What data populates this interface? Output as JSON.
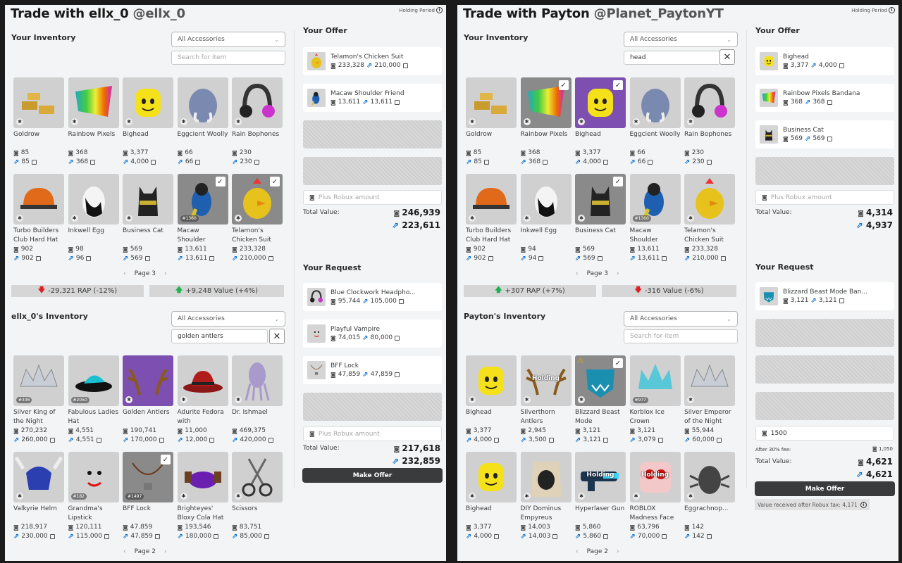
{
  "holding_label": "Holding Period",
  "left": {
    "title": "Trade with ellx_0",
    "handle": "@ellx_0",
    "your_inventory": {
      "label": "Your Inventory",
      "filter": "All Accessories",
      "search": "Search for item",
      "page": "Page 3",
      "items": [
        {
          "name": "Goldrow",
          "rap": "85",
          "value": "85",
          "icon": "gold-bars-icon"
        },
        {
          "name": "Rainbow Pixels",
          "rap": "368",
          "value": "368",
          "icon": "rainbow-bandana-icon"
        },
        {
          "name": "Bighead",
          "rap": "3,377",
          "value": "4,000",
          "icon": "yellow-head-icon"
        },
        {
          "name": "Eggcient Woolly",
          "rap": "66",
          "value": "66",
          "icon": "mammoth-egg-icon"
        },
        {
          "name": "Rain Bophones",
          "rap": "230",
          "value": "230",
          "icon": "headphones-icon"
        },
        {
          "name": "Turbo Builders Club Hard Hat",
          "rap": "902",
          "value": "902",
          "icon": "hard-hat-icon"
        },
        {
          "name": "Inkwell Egg",
          "rap": "98",
          "value": "96",
          "icon": "egg-icon"
        },
        {
          "name": "Business Cat",
          "rap": "569",
          "value": "569",
          "icon": "cat-icon"
        },
        {
          "name": "Macaw Shoulder",
          "rap": "13,611",
          "value": "13,611",
          "icon": "macaw-icon",
          "selected": true,
          "serial": "#1360"
        },
        {
          "name": "Telamon's Chicken Suit",
          "rap": "233,328",
          "value": "210,000",
          "icon": "chicken-icon",
          "selected": true
        }
      ]
    },
    "rap_stat": "-29,321 RAP (-12%)",
    "value_stat": "+9,248 Value (+4%)",
    "their_inventory": {
      "label": "ellx_0's Inventory",
      "filter": "All Accessories",
      "search": "golden antlers",
      "page": "Page 2",
      "items": [
        {
          "name": "Silver King of the Night",
          "rap": "270,232",
          "value": "260,000",
          "icon": "silver-crown-icon",
          "serial": "#336"
        },
        {
          "name": "Fabulous Ladies Hat",
          "rap": "4,551",
          "value": "4,551",
          "icon": "teal-hat-icon",
          "serial": "#2050"
        },
        {
          "name": "Golden Antlers",
          "rap": "190,741",
          "value": "170,000",
          "icon": "antlers-icon",
          "purple": true
        },
        {
          "name": "Adurite Fedora with",
          "rap": "11,000",
          "value": "12,000",
          "icon": "fedora-icon"
        },
        {
          "name": "Dr. Ishmael",
          "rap": "469,375",
          "value": "420,000",
          "icon": "squid-icon"
        },
        {
          "name": "Valkyrie Helm",
          "rap": "218,917",
          "value": "230,000",
          "icon": "valkyrie-helm-icon"
        },
        {
          "name": "Grandma's Lipstick",
          "rap": "120,111",
          "value": "115,000",
          "icon": "face-icon",
          "serial": "#182"
        },
        {
          "name": "BFF Lock",
          "rap": "47,859",
          "value": "47,859",
          "icon": "lock-necklace-icon",
          "selected": true,
          "serial": "#1497"
        },
        {
          "name": "Brighteyes' Bloxy Cola Hat",
          "rap": "193,546",
          "value": "180,000",
          "icon": "cola-hat-icon"
        },
        {
          "name": "Scissors",
          "rap": "83,751",
          "value": "85,000",
          "icon": "scissors-icon"
        }
      ]
    },
    "offer": {
      "label": "Your Offer",
      "items": [
        {
          "name": "Telamon's Chicken Suit",
          "rap": "233,328",
          "value": "210,000",
          "icon": "chicken-icon"
        },
        {
          "name": "Macaw Shoulder Friend",
          "rap": "13,611",
          "value": "13,611",
          "icon": "macaw-icon"
        }
      ],
      "plus": "Plus Robux amount",
      "total_label": "Total Value:",
      "total_rap": "246,939",
      "total_value": "223,611"
    },
    "request": {
      "label": "Your Request",
      "items": [
        {
          "name": "Blue Clockwork Headpho...",
          "rap": "95,744",
          "value": "105,000",
          "icon": "headphones-icon"
        },
        {
          "name": "Playful Vampire",
          "rap": "74,015",
          "value": "80,000",
          "icon": "face-icon"
        },
        {
          "name": "BFF Lock",
          "rap": "47,859",
          "value": "47,859",
          "icon": "lock-necklace-icon"
        }
      ],
      "plus": "Plus Robux amount",
      "total_label": "Total Value:",
      "total_rap": "217,618",
      "total_value": "232,859"
    },
    "make_offer": "Make Offer"
  },
  "right": {
    "title": "Trade with Payton",
    "handle": "@Planet_PaytonYT",
    "your_inventory": {
      "label": "Your Inventory",
      "filter": "All Accessories",
      "search": "head",
      "page": "Page 3",
      "items": [
        {
          "name": "Goldrow",
          "rap": "85",
          "value": "85",
          "icon": "gold-bars-icon"
        },
        {
          "name": "Rainbow Pixels",
          "rap": "368",
          "value": "368",
          "icon": "rainbow-bandana-icon",
          "selected": true
        },
        {
          "name": "Bighead",
          "rap": "3,377",
          "value": "4,000",
          "icon": "yellow-head-icon",
          "selected": true,
          "purple": true
        },
        {
          "name": "Eggcient Woolly",
          "rap": "66",
          "value": "66",
          "icon": "mammoth-egg-icon"
        },
        {
          "name": "Rain Bophones",
          "rap": "230",
          "value": "230",
          "icon": "headphones-icon"
        },
        {
          "name": "Turbo Builders Club Hard Hat",
          "rap": "902",
          "value": "902",
          "icon": "hard-hat-icon"
        },
        {
          "name": "Inkwell Egg",
          "rap": "94",
          "value": "94",
          "icon": "egg-icon"
        },
        {
          "name": "Business Cat",
          "rap": "569",
          "value": "569",
          "icon": "cat-icon",
          "selected": true
        },
        {
          "name": "Macaw Shoulder",
          "rap": "13,611",
          "value": "13,611",
          "icon": "macaw-icon",
          "serial": "#1360"
        },
        {
          "name": "Telamon's Chicken Suit",
          "rap": "233,328",
          "value": "210,000",
          "icon": "chicken-icon"
        }
      ]
    },
    "rap_stat": "+307 RAP (+7%)",
    "value_stat": "-316 Value (-6%)",
    "their_inventory": {
      "label": "Payton's Inventory",
      "filter": "All Accessories",
      "search": "Search for item",
      "page": "Page 2",
      "items": [
        {
          "name": "Bighead",
          "rap": "3,377",
          "value": "4,000",
          "icon": "yellow-head-icon"
        },
        {
          "name": "Silverthorn Antlers",
          "rap": "2,945",
          "value": "3,500",
          "icon": "antlers-icon",
          "holding": "Holding"
        },
        {
          "name": "Blizzard Beast Mode",
          "rap": "3,121",
          "value": "3,121",
          "icon": "beast-mask-icon",
          "selected": true,
          "warn": true
        },
        {
          "name": "Korblox Ice Crown",
          "rap": "3,121",
          "value": "3,079",
          "icon": "ice-crown-icon",
          "serial": "#977"
        },
        {
          "name": "Silver Emperor of the Night",
          "rap": "55,944",
          "value": "60,000",
          "icon": "silver-crown-icon"
        },
        {
          "name": "Bighead",
          "rap": "3,377",
          "value": "4,000",
          "icon": "yellow-head-icon"
        },
        {
          "name": "DIY Dominus Empyreus",
          "rap": "14,003",
          "value": "14,003",
          "icon": "dominus-icon"
        },
        {
          "name": "Hyperlaser Gun",
          "rap": "5,860",
          "value": "5,860",
          "icon": "laser-gun-icon",
          "holding": "Holding"
        },
        {
          "name": "ROBLOX Madness Face",
          "rap": "63,796",
          "value": "70,000",
          "icon": "madness-face-icon",
          "holding": "Holding"
        },
        {
          "name": "Eggrachnop...",
          "rap": "142",
          "value": "142",
          "icon": "spider-egg-icon"
        }
      ]
    },
    "offer": {
      "label": "Your Offer",
      "items": [
        {
          "name": "Bighead",
          "rap": "3,377",
          "value": "4,000",
          "icon": "yellow-head-icon"
        },
        {
          "name": "Rainbow Pixels Bandana",
          "rap": "368",
          "value": "368",
          "icon": "rainbow-bandana-icon"
        },
        {
          "name": "Business Cat",
          "rap": "569",
          "value": "569",
          "icon": "cat-icon"
        }
      ],
      "plus": "Plus Robux amount",
      "total_label": "Total Value:",
      "total_rap": "4,314",
      "total_value": "4,937"
    },
    "request": {
      "label": "Your Request",
      "items": [
        {
          "name": "Blizzard Beast Mode Ban...",
          "rap": "3,121",
          "value": "3,121",
          "icon": "beast-mask-icon"
        }
      ],
      "plus": "1500",
      "fee_label": "After 30% fee:",
      "fee_value": "1,050",
      "total_label": "Total Value:",
      "total_rap": "4,621",
      "total_value": "4,621"
    },
    "make_offer": "Make Offer",
    "tax_note": "Value received after Robux tax: 4,171"
  }
}
